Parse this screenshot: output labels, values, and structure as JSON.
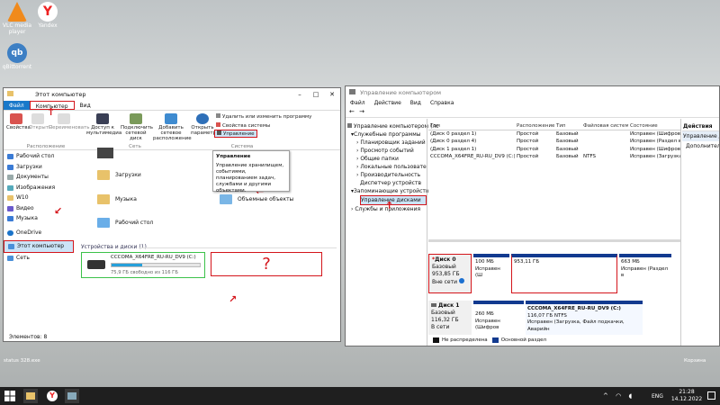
{
  "desktop": {
    "icons": [
      {
        "label": "VLC media player",
        "color": "#f08a1c"
      },
      {
        "label": "Yandex",
        "color": "#ffffff"
      },
      {
        "label": "qBittorrent",
        "color": "#3d7fc4"
      }
    ],
    "bottom_left_text": "status 328.exe",
    "bottom_right_text": "Корзина"
  },
  "explorer": {
    "title": "Этот компьютер",
    "tabs": [
      "Файл",
      "Компьютер",
      "Вид"
    ],
    "ribbon": {
      "properties": "Свойства",
      "open": "Открыть",
      "rename": "Переименовать",
      "location_group": "Расположение",
      "media_access": "Доступ к мультимедиа",
      "map_drive": "Подключить сетевой диск",
      "add_location": "Добавить сетевое расположение",
      "network_group": "Сеть",
      "open_params": "Открыть параметры",
      "uninstall": "Удалить или изменить программу",
      "sys_props": "Свойства системы",
      "manage": "Управление",
      "system_group": "Система"
    },
    "tooltip": {
      "title": "Управление",
      "body": "Управление хранилищем, событиями, планированием задач, службами и другими объектами."
    },
    "nav": [
      "Рабочий стол",
      "Загрузки",
      "Документы",
      "Изображения",
      "W10",
      "Видео",
      "Музыка",
      "OneDrive",
      "Этот компьютер",
      "Сеть"
    ],
    "folders": [
      "Загрузки",
      "Музыка",
      "Объемные объекты",
      "Рабочий стол"
    ],
    "devices_header": "Устройства и диски (1)",
    "drive": {
      "name": "CCCOMA_X64FRE_RU-RU_DV9 (C:)",
      "free": "75,9 ГБ свободно из 116 ГБ",
      "fill": 0.35
    },
    "question": "?",
    "status": "Элементов: 8"
  },
  "mgmt": {
    "title": "Управление компьютером",
    "menu": [
      "Файл",
      "Действие",
      "Вид",
      "Справка"
    ],
    "tree": [
      "Управление компьютером (лс",
      "Служебные программы",
      "Планировщик заданий",
      "Просмотр событий",
      "Общие папки",
      "Локальные пользовате",
      "Производительность",
      "Диспетчер устройств",
      "Запоминающие устройств",
      "Управление дисками",
      "Службы и приложения"
    ],
    "columns": [
      "Том",
      "Расположение",
      "Тип",
      "Файловая система",
      "Состояние"
    ],
    "rows": [
      [
        "(Диск 0 раздел 1)",
        "Простой",
        "Базовый",
        "",
        "Исправен (Шифрова"
      ],
      [
        "(Диск 0 раздел 4)",
        "Простой",
        "Базовый",
        "",
        "Исправен (Раздел в"
      ],
      [
        "(Диск 1 раздел 1)",
        "Простой",
        "Базовый",
        "",
        "Исправен (Шифрова"
      ],
      [
        "CCCOMA_X64FRE_RU-RU_DV9 (C:)",
        "Простой",
        "Базовый",
        "NTFS",
        "Исправен (Загрузка,"
      ]
    ],
    "actions_header": "Действия",
    "actions": [
      "Управление дисками",
      "Дополнительн"
    ],
    "disk0": {
      "name": "Диск 0",
      "type": "Базовый",
      "size": "953,85 ГБ",
      "state": "Вне сети"
    },
    "disk0_parts": [
      {
        "size": "100 МБ",
        "status": "Исправен (Ш"
      },
      {
        "size": "953,11 ГБ",
        "status": ""
      },
      {
        "size": "663 МБ",
        "status": "Исправен (Раздел в"
      }
    ],
    "disk1": {
      "name": "Диск 1",
      "type": "Базовый",
      "size": "116,32 ГБ",
      "state": "В сети"
    },
    "disk1_parts": [
      {
        "size": "260 МБ",
        "status": "Исправен (Шифров"
      },
      {
        "name": "CCCOMA_X64FRE_RU-RU_DV9 (C:)",
        "size": "116,07 ГБ NTFS",
        "status": "Исправен (Загрузка, Файл подкачки, Аварийн"
      }
    ],
    "legend": [
      "Не распределена",
      "Основной раздел"
    ],
    "colors": {
      "primary": "#123a8f",
      "unallocated": "#111111"
    }
  },
  "taskbar": {
    "lang": "ENG",
    "time": "21:28",
    "date": "14.12.2022"
  }
}
